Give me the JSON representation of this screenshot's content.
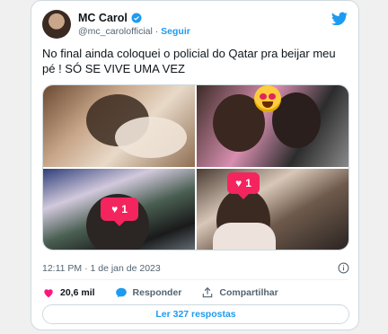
{
  "tweet": {
    "author": {
      "name": "MC Carol",
      "handle": "@mc_carolofficial",
      "separator": "·",
      "follow_label": "Seguir",
      "verified": true
    },
    "text": "No final ainda coloquei o policial do Qatar pra beijar meu pé ! SÓ SE VIVE UMA VEZ",
    "media": [
      {
        "icon": "photo-closeup"
      },
      {
        "icon": "photo-couple-emoji",
        "overlay_icon": "heart-eyes-emoji-icon"
      },
      {
        "icon": "photo-stadium-selfie",
        "badge_count": "1"
      },
      {
        "icon": "photo-hotel-room",
        "badge_count": "1"
      }
    ],
    "timestamp": "12:11 PM · 1 de jan de 2023",
    "actions": {
      "likes": "20,6 mil",
      "reply_label": "Responder",
      "share_label": "Compartilhar"
    },
    "read_replies_label": "Ler 327 respostas"
  },
  "colors": {
    "accent": "#1d9bf0",
    "like": "#f91880",
    "badge": "#f4245e",
    "muted": "#536471"
  }
}
